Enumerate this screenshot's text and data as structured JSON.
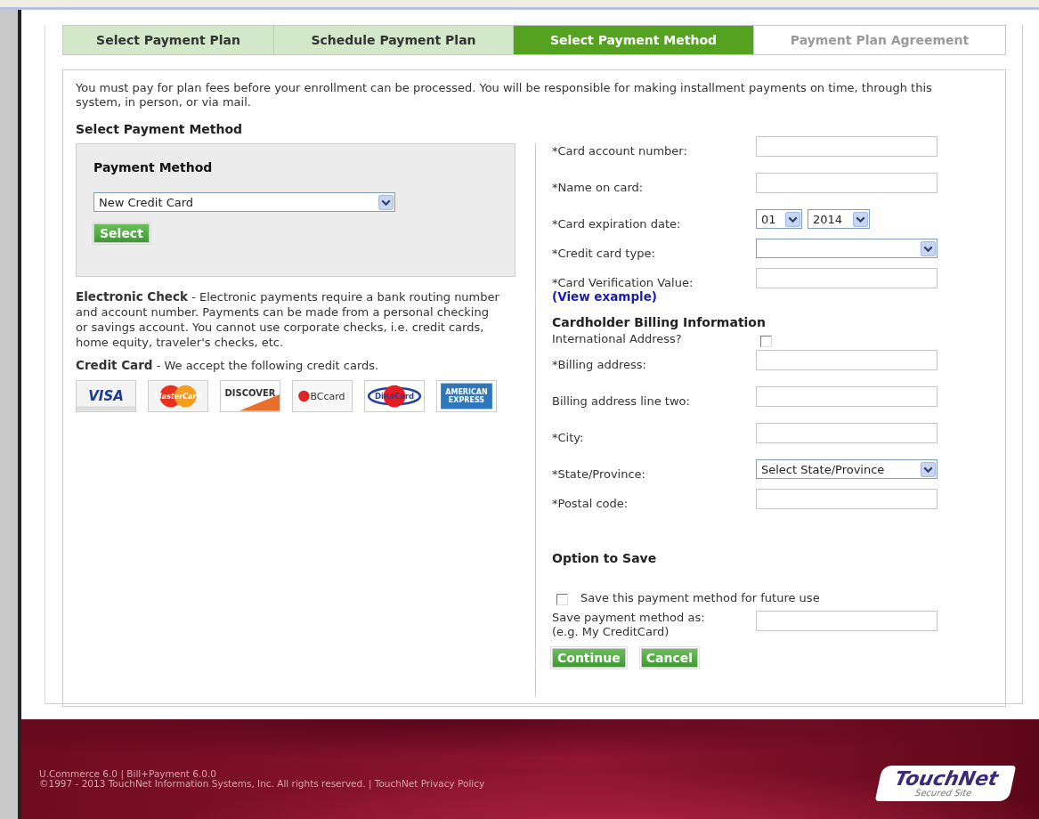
{
  "tabs": [
    {
      "label": "Select Payment Plan",
      "selected": false,
      "disabled": false
    },
    {
      "label": "Schedule Payment Plan",
      "selected": false,
      "disabled": false
    },
    {
      "label": "Select Payment Method",
      "selected": true,
      "disabled": false
    },
    {
      "label": "Payment Plan Agreement",
      "selected": false,
      "disabled": true
    }
  ],
  "intro": "You must pay for plan fees before your enrollment can be processed.  You will be responsible for making installment payments on time, through this system, in person, or via mail.",
  "section_title": "Select Payment Method",
  "payment_box": {
    "title": "Payment Method",
    "value": "New Credit Card",
    "button": "Select"
  },
  "electronic_check": "**Electronic Check** - Electronic payments require a bank routing number and account number. Payments can be made from a personal checking or savings account. You cannot use corporate checks, i.e. credit cards, home equity, traveler's checks, etc.",
  "credit_card_note": "**Credit Card** - We accept the following credit cards.",
  "cards": [
    {
      "kind": "visa",
      "label": "VISA"
    },
    {
      "kind": "mastercard",
      "label": "MasterCard"
    },
    {
      "kind": "discover",
      "label": "DISCOVER"
    },
    {
      "kind": "bccard",
      "label": "BCcard"
    },
    {
      "kind": "dinacard",
      "label": "DinaCard"
    },
    {
      "kind": "amex",
      "label": "AMERICAN EXPRESS"
    }
  ],
  "form": [
    {
      "kind": "text",
      "label": "*Card account number:"
    },
    {
      "kind": "text",
      "label": "*Name on card:"
    },
    {
      "kind": "date",
      "label": "*Card expiration date:",
      "month": "01",
      "year": "2014"
    },
    {
      "kind": "select",
      "label": "*Credit card type:"
    },
    {
      "kind": "text",
      "label": "*Card Verification Value:",
      "link": "(View example)"
    },
    {
      "kind": "heading",
      "label": "Cardholder Billing Information"
    },
    {
      "kind": "checkbox",
      "label": "International Address?",
      "checked": false
    },
    {
      "kind": "text",
      "label": "*Billing address:"
    },
    {
      "kind": "text",
      "label": "Billing address line two:"
    },
    {
      "kind": "text",
      "label": "*City:"
    },
    {
      "kind": "select",
      "label": "*State/Province:",
      "value": "Select State/Province"
    },
    {
      "kind": "text",
      "label": "*Postal code:"
    }
  ],
  "save": {
    "title": "Option to Save",
    "checkbox": {
      "label": "Save this payment method for future use",
      "checked": false
    },
    "name_label": "Save payment method as:",
    "name_hint": "(e.g. My CreditCard)"
  },
  "buttons": [
    "Continue",
    "Cancel"
  ],
  "footer": {
    "lines": [
      "U.Commerce 6.0 | Bill+Payment 6.0.0",
      "©1997 - 2013 TouchNet Information Systems, Inc. All rights reserved. | TouchNet Privacy Policy"
    ],
    "logo": {
      "name": "TouchNet",
      "tagline": "Secured Site"
    }
  }
}
